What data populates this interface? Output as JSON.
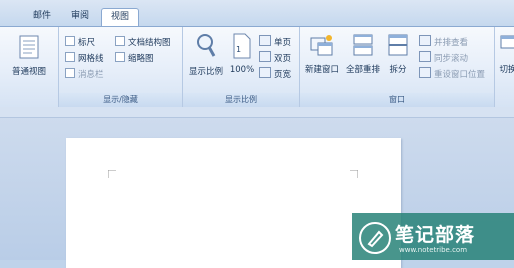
{
  "tabs": [
    "邮件",
    "审阅",
    "视图"
  ],
  "groups": {
    "views": {
      "label": "普通视图"
    },
    "show_hide": {
      "label": "显示/隐藏",
      "items": [
        "标尺",
        "文档结构图",
        "网格线",
        "缩略图",
        "消息栏"
      ]
    },
    "zoom": {
      "label": "显示比例",
      "zoom_button": "显示比例",
      "percent_button": "100%",
      "one_page": "单页",
      "two_pages": "双页",
      "page_width": "页宽"
    },
    "window": {
      "label": "窗口",
      "new_window": "新建窗口",
      "arrange_all": "全部重排",
      "split": "拆分",
      "side_by_side": "并排查看",
      "sync_scroll": "同步滚动",
      "reset_position": "重设窗口位置",
      "switch": "切换"
    }
  },
  "watermark": {
    "title": "笔记部落",
    "url": "www.notetribe.com"
  },
  "colors": {
    "ribbon_text": "#1e395b",
    "watermark_bg": "#28827a"
  }
}
